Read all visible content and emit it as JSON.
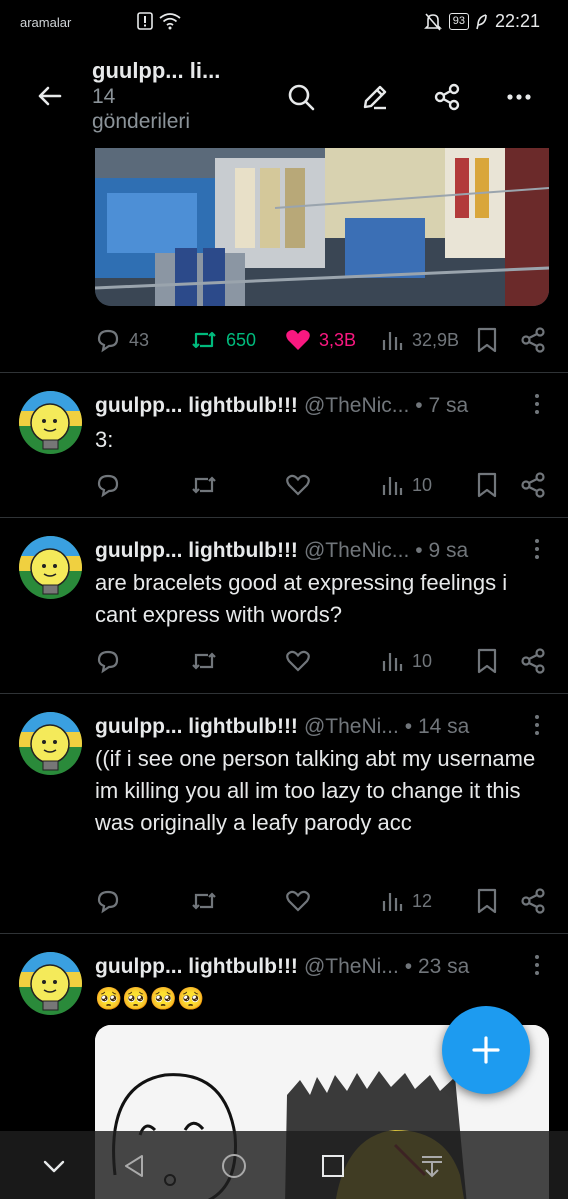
{
  "status_bar": {
    "carrier": "aramalar",
    "battery": "93",
    "time": "22:21"
  },
  "header": {
    "title": "guulpp... li...",
    "count": "14",
    "count_label": "gönderileri"
  },
  "top_tweet_actions": {
    "replies": "43",
    "reposts": "650",
    "likes": "3,3B",
    "views": "32,9B"
  },
  "tweets": [
    {
      "name": "guulpp... lightbulb!!!",
      "handle": "@TheNic...",
      "time": "• 7 sa",
      "text": "3:",
      "views": "10"
    },
    {
      "name": "guulpp... lightbulb!!!",
      "handle": "@TheNic...",
      "time": "• 9 sa",
      "text": "are bracelets good at expressing feelings i cant express with words?",
      "views": "10"
    },
    {
      "name": "guulpp... lightbulb!!!",
      "handle": "@TheNi...",
      "time": "• 14 sa",
      "text": "((if i see one person talking abt my username im killing you all im too lazy to change it this was originally a leafy parody acc",
      "views": "12"
    },
    {
      "name": "guulpp... lightbulb!!!",
      "handle": "@TheNi...",
      "time": "• 23 sa",
      "text": "🥺🥺🥺🥺",
      "views": ""
    }
  ],
  "colors": {
    "accent": "#1d9bf0",
    "repost": "#00ba7c",
    "like": "#f91880",
    "muted": "#71767b"
  },
  "icons": [
    "back-arrow-icon",
    "search-icon",
    "edit-icon",
    "share-icon",
    "more-icon",
    "reply-icon",
    "repost-icon",
    "like-icon",
    "views-icon",
    "bookmark-icon",
    "plus-icon"
  ]
}
